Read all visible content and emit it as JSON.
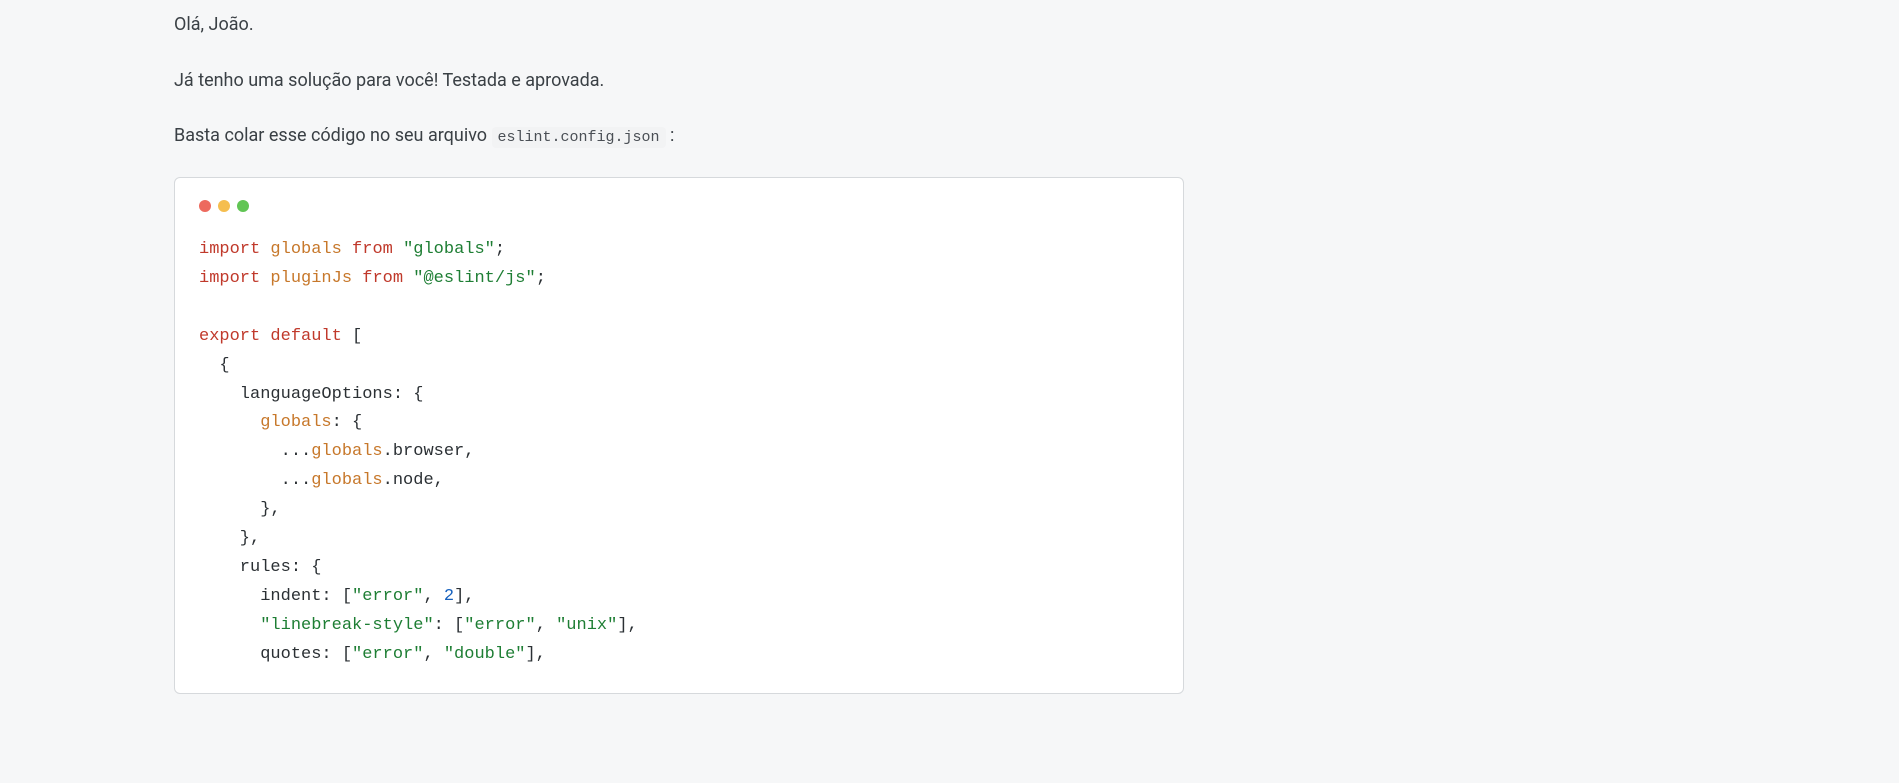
{
  "post": {
    "greeting": "Olá, João.",
    "line2": "Já tenho uma solução para você! Testada e aprovada.",
    "line3_prefix": "Basta colar esse código no seu arquivo ",
    "line3_code": "eslint.config.json",
    "line3_suffix": " :"
  },
  "code": {
    "s_import1": "import",
    "s_globals1": "globals",
    "s_from1": "from",
    "s_str_globals": "\"globals\"",
    "s_semi1": ";",
    "s_import2": "import",
    "s_pluginJs": "pluginJs",
    "s_from2": "from",
    "s_str_eslintjs": "\"@eslint/js\"",
    "s_semi2": ";",
    "s_export": "export",
    "s_default": "default",
    "s_lbracket": " [",
    "s_lbrace1": "  {",
    "s_langOpts_prefix": "    languageOptions",
    "s_colon_lbrace1": ": {",
    "s_globals_prop": "globals",
    "s_globals_prefix": "      ",
    "s_colon_lbrace2": ": {",
    "s_spread1_prefix": "        ...",
    "s_spread_globals1": "globals",
    "s_browser": ".browser,",
    "s_spread2_prefix": "        ...",
    "s_spread_globals2": "globals",
    "s_node": ".node,",
    "s_close_globals": "      },",
    "s_close_langOpts": "    },",
    "s_rules_prefix": "    rules",
    "s_colon_lbrace3": ": {",
    "s_indent_prefix": "      indent",
    "s_indent_mid1": ": [",
    "s_err1": "\"error\"",
    "s_indent_mid2": ", ",
    "s_two": "2",
    "s_indent_suffix": "],",
    "s_lbs_prefix": "      ",
    "s_lbs_key": "\"linebreak-style\"",
    "s_lbs_mid1": ": [",
    "s_err2": "\"error\"",
    "s_lbs_mid2": ", ",
    "s_unix": "\"unix\"",
    "s_lbs_suffix": "],",
    "s_quotes_prefix": "      quotes",
    "s_quotes_mid1": ": [",
    "s_err3": "\"error\"",
    "s_quotes_mid2": ", ",
    "s_double": "\"double\"",
    "s_quotes_suffix": "],"
  }
}
